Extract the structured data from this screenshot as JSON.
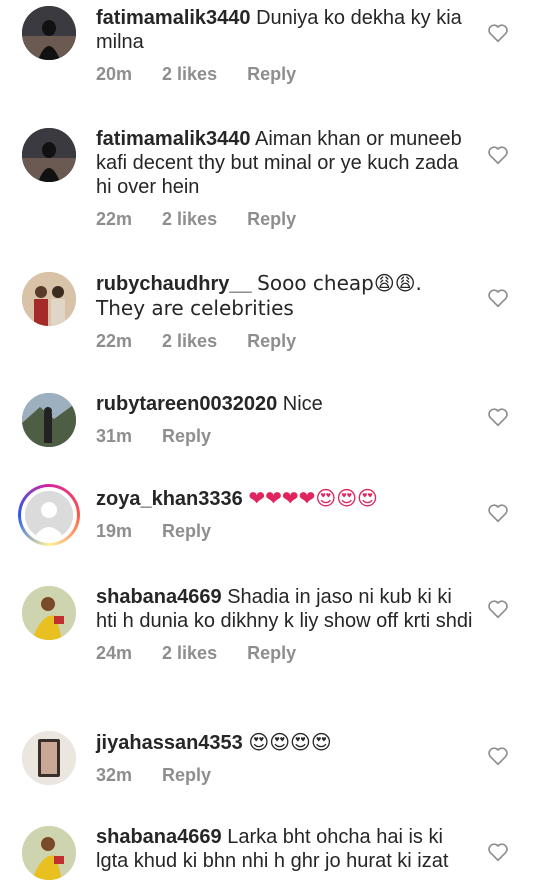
{
  "comments": [
    {
      "username": "fatimamalik3440",
      "text": "Duniya ko dekha ky kia milna",
      "time": "20m",
      "likes": "2 likes",
      "reply": "Reply"
    },
    {
      "username": "fatimamalik3440",
      "text": "Aiman khan or muneeb kafi decent thy but minal or ye kuch zada hi over hein",
      "time": "22m",
      "likes": "2 likes",
      "reply": "Reply"
    },
    {
      "username": "rubychaudhry__",
      "text": "Sooo cheap😩😩. They are celebrities",
      "time": "22m",
      "likes": "2 likes",
      "reply": "Reply"
    },
    {
      "username": "rubytareen0032020",
      "text": "Nice",
      "time": "31m",
      "reply": "Reply"
    },
    {
      "username": "zoya_khan3336",
      "text": "❤❤❤❤😍😍😍",
      "time": "19m",
      "reply": "Reply"
    },
    {
      "username": "shabana4669",
      "text": "Shadia in jaso ni kub ki ki hti h dunia ko dikhny k liy show off krti shdi",
      "time": "24m",
      "likes": "2 likes",
      "reply": "Reply"
    },
    {
      "username": "jiyahassan4353",
      "text": "😍😍😍😍",
      "time": "32m",
      "reply": "Reply"
    },
    {
      "username": "shabana4669",
      "text": "Larka bht ohcha hai is ki lgta khud ki bhn nhi h ghr jo hurat ki izat"
    }
  ],
  "colors": {
    "text": "#262626",
    "meta": "#8e8e8e",
    "heart": "#8e8e8e"
  },
  "icons": {
    "like": "heart-outline-icon"
  }
}
